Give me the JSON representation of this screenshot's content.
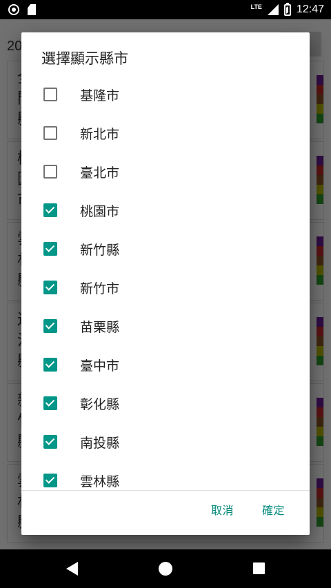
{
  "status_bar": {
    "time": "12:47",
    "network": "LTE",
    "icons": [
      "notification-circle-icon",
      "sd-card-icon",
      "signal-icon",
      "battery-charging-icon"
    ]
  },
  "background": {
    "header_text": "20",
    "cards": [
      {
        "lines": [
          "全",
          "門",
          "縣"
        ]
      },
      {
        "lines": [
          "桃",
          "園",
          "市"
        ]
      },
      {
        "lines": [
          "雲",
          "林",
          "縣"
        ]
      },
      {
        "lines": [
          "連",
          "江",
          "縣"
        ]
      },
      {
        "lines": [
          "新",
          "竹",
          "縣"
        ]
      },
      {
        "lines": [
          "雲",
          "林",
          "縣"
        ]
      }
    ],
    "bar_colors": [
      "#6a1b9a",
      "#c62828",
      "#8d5524",
      "#b5b800",
      "#2e9e2e"
    ]
  },
  "dialog": {
    "title": "選擇顯示縣市",
    "options": [
      {
        "label": "基隆市",
        "checked": false
      },
      {
        "label": "新北市",
        "checked": false
      },
      {
        "label": "臺北市",
        "checked": false
      },
      {
        "label": "桃園市",
        "checked": true
      },
      {
        "label": "新竹縣",
        "checked": true
      },
      {
        "label": "新竹市",
        "checked": true
      },
      {
        "label": "苗栗縣",
        "checked": true
      },
      {
        "label": "臺中市",
        "checked": true
      },
      {
        "label": "彰化縣",
        "checked": true
      },
      {
        "label": "南投縣",
        "checked": true
      },
      {
        "label": "雲林縣",
        "checked": true
      }
    ],
    "cancel_label": "取消",
    "ok_label": "確定"
  },
  "colors": {
    "accent": "#009688",
    "button_text": "#00897b"
  }
}
